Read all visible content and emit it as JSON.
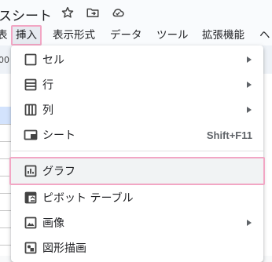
{
  "header": {
    "title": "スシート"
  },
  "menubar": {
    "items": [
      {
        "label": "表"
      },
      {
        "label": "挿入"
      },
      {
        "label": "表示形式"
      },
      {
        "label": "データ"
      },
      {
        "label": "ツール"
      },
      {
        "label": "拡張機能"
      },
      {
        "label": "ヘ"
      }
    ]
  },
  "toolbar": {
    "fragment": "00"
  },
  "insert_menu": {
    "items": [
      {
        "label": "セル",
        "icon": "cell-square-icon",
        "has_submenu": true
      },
      {
        "label": "行",
        "icon": "rows-icon",
        "has_submenu": true
      },
      {
        "label": "列",
        "icon": "columns-icon",
        "has_submenu": true
      },
      {
        "label": "シート",
        "icon": "sheet-icon",
        "shortcut": "Shift+F11"
      },
      {
        "label": "グラフ",
        "icon": "chart-icon",
        "highlighted": true
      },
      {
        "label": "ピボット テーブル",
        "icon": "pivot-table-icon"
      },
      {
        "label": "画像",
        "icon": "image-icon",
        "has_submenu": true
      },
      {
        "label": "図形描画",
        "icon": "drawing-icon"
      }
    ]
  },
  "colors": {
    "highlight_outline": "#f2a6c4",
    "menu_hover": "#f1f3f4",
    "active_menu_bg": "#e6eaf0"
  }
}
